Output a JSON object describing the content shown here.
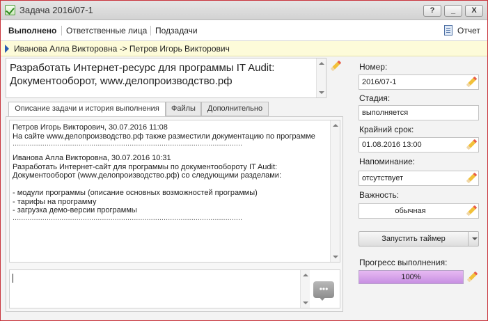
{
  "window": {
    "title": "Задача 2016/07-1",
    "buttons": {
      "help": "?",
      "minimize": "_",
      "close": "X"
    }
  },
  "toolbar": {
    "done": "Выполнено",
    "responsible": "Ответственные лица",
    "subtasks": "Подзадачи",
    "report": "Отчет"
  },
  "assignment": "Иванова Алла Викторовна -> Петров Игорь Викторович",
  "subject": "Разработать Интернет-ресурс для программы IT Audit: Документооборот, www.делопроизводство.рф",
  "tabs": [
    {
      "label": "Описание задачи и история выполнения",
      "active": true
    },
    {
      "label": "Файлы",
      "active": false
    },
    {
      "label": "Дополнительно",
      "active": false
    }
  ],
  "history": {
    "entry1": {
      "header": "Петров Игорь Викторович, 30.07.2016 11:08",
      "text": "На сайте www.делопроизводство.рф также разместили документацию по программе",
      "separator": "............................................................................................................"
    },
    "entry2": {
      "header": "Иванова Алла Викторовна, 30.07.2016 10:31",
      "line1": "Разработать Интернет-сайт для программы по документообороту IT Audit:",
      "line2": "Документооборот (www.делопроизводство.рф) со следующими разделами:",
      "bullets": [
        "- модули программы (описание основных возможностей программы)",
        "- тарифы на программу",
        "- загрузка демо-версии программы"
      ],
      "separator": "............................................................................................................"
    }
  },
  "comment": {
    "value": "",
    "send_icon": "speech-bubble-icon",
    "send_dots": "•••"
  },
  "fields": {
    "number": {
      "label": "Номер:",
      "value": "2016/07-1"
    },
    "stage": {
      "label": "Стадия:",
      "value": "выполняется"
    },
    "deadline": {
      "label": "Крайний срок:",
      "value": "01.08.2016 13:00"
    },
    "reminder": {
      "label": "Напоминание:",
      "value": "отсутствует"
    },
    "importance": {
      "label": "Важность:",
      "value": "обычная"
    }
  },
  "timer": {
    "label": "Запустить таймер"
  },
  "progress": {
    "label": "Прогресс выполнения:",
    "value_text": "100%",
    "fraction": 1.0
  },
  "colors": {
    "accent_border": "#c8323a",
    "assignment_bg": "#fdfbd9",
    "progress_fill": "#d7a4ea"
  }
}
